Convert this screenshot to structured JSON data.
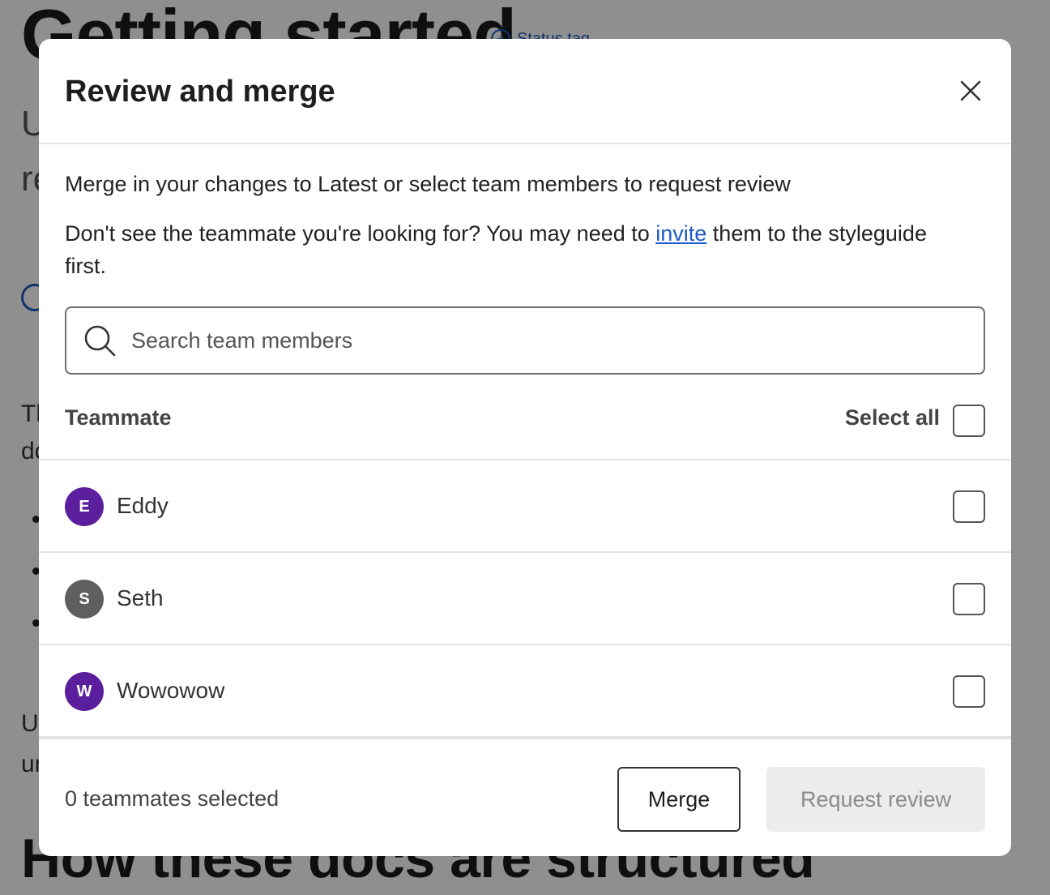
{
  "background": {
    "title": "Getting started",
    "status_tag": "Status tag",
    "status_icon": "plus-circle-icon",
    "line_u": "U",
    "line_r": "re",
    "line_th": "Th",
    "line_do": "do",
    "line_us": "Us",
    "line_un": "un",
    "heading2": "How these docs are structured"
  },
  "modal": {
    "title": "Review and merge",
    "close_icon": "close-icon",
    "description": "Merge in your changes to Latest or select team members to request review",
    "invite_prefix": "Don't see the teammate you're looking for? You may need to ",
    "invite_link": "invite",
    "invite_suffix": " them to the styleguide first.",
    "search": {
      "placeholder": "Search team members",
      "value": "",
      "icon": "search-icon"
    },
    "list": {
      "column_label": "Teammate",
      "select_all_label": "Select all",
      "select_all_checked": false,
      "members": [
        {
          "initial": "E",
          "name": "Eddy",
          "avatar_color": "#5b1f9e",
          "checked": false
        },
        {
          "initial": "S",
          "name": "Seth",
          "avatar_color": "#5f5f5f",
          "checked": false
        },
        {
          "initial": "W",
          "name": "Wowowow",
          "avatar_color": "#5b1f9e",
          "checked": false
        }
      ]
    },
    "footer": {
      "selected_count": "0 teammates selected",
      "merge_label": "Merge",
      "request_review_label": "Request review",
      "request_review_disabled": true
    }
  },
  "colors": {
    "overlay": "#8c8c8c",
    "link": "#1f5bc6",
    "avatar_purple": "#5b1f9e",
    "avatar_gray": "#5f5f5f"
  }
}
